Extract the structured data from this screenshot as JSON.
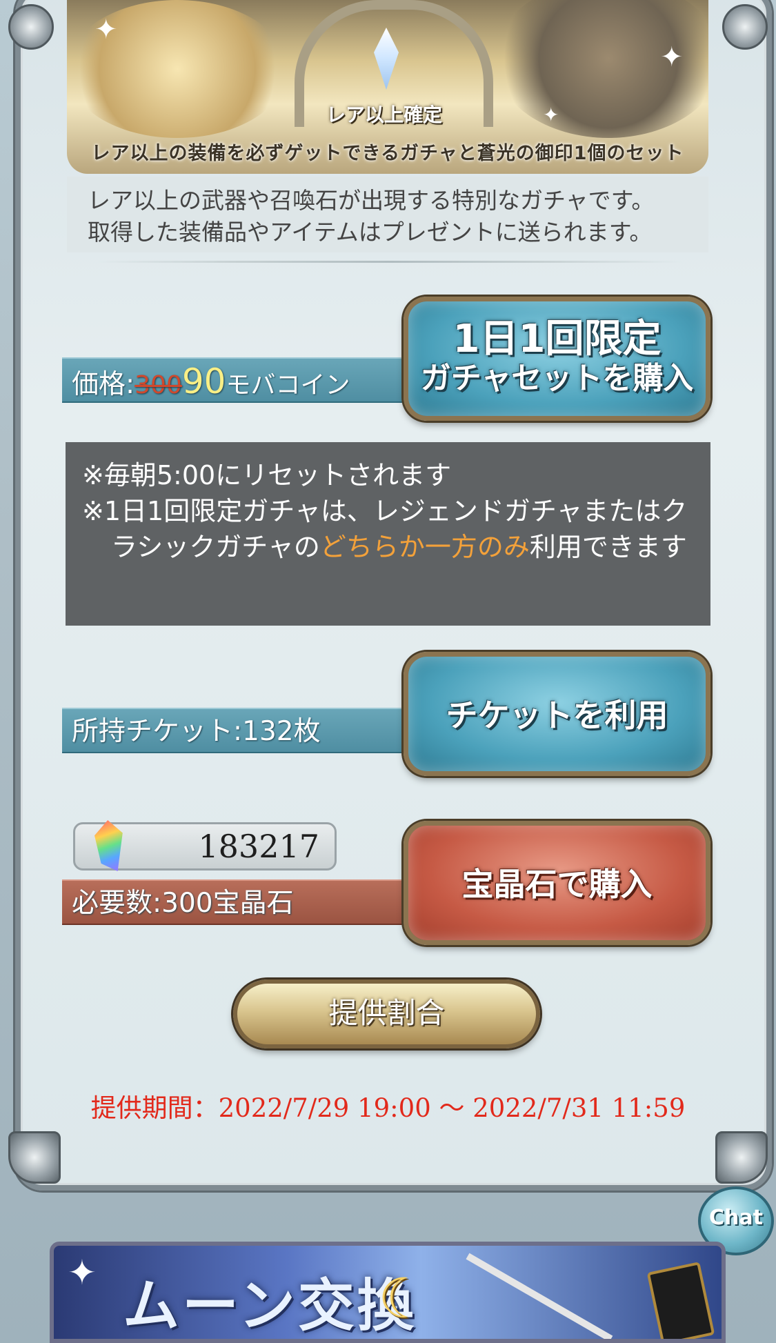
{
  "banner": {
    "tag": "レア以上確定",
    "caption": "レア以上の装備を必ずゲットできるガチャと蒼光の御印1個のセット"
  },
  "description": {
    "line1": "レア以上の武器や召喚石が出現する特別なガチャです。",
    "line2": "取得した装備品やアイテムはプレゼントに送られます。"
  },
  "price_row": {
    "label": "価格:",
    "original_price": "300",
    "sale_price": "90",
    "unit": "モバコイン",
    "button_line1": "1日1回限定",
    "button_line2": "ガチャセットを購入"
  },
  "notice": {
    "item1": "※毎朝5:00にリセットされます",
    "item2_prefix": "※1日1回限定ガチャは、レジェンドガチャまたはクラシックガチャの",
    "item2_highlight": "どちらか一方のみ",
    "item2_suffix": "利用できます"
  },
  "ticket_row": {
    "label": "所持チケット:132枚",
    "button_label": "チケットを利用"
  },
  "gem_row": {
    "count": "183217",
    "required_label": "必要数:300宝晶石",
    "button_label": "宝晶石で購入"
  },
  "rates_button": "提供割合",
  "period": "提供期間：2022/7/29 19:00 〜 2022/7/31 11:59",
  "chat_button": "Chat",
  "moon_banner": "ムーン交換",
  "icons": [
    "crystal-icon",
    "gem-icon",
    "moon-icon",
    "chat-icon"
  ]
}
